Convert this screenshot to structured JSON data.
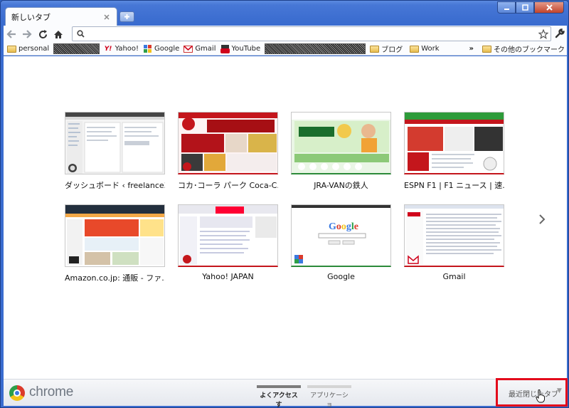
{
  "window": {
    "buttons": [
      "minimize",
      "maximize",
      "close"
    ]
  },
  "tab": {
    "title": "新しいタブ",
    "close_icon": "close-icon",
    "new_tab_icon": "plus-icon"
  },
  "toolbar": {
    "back_icon": "back-arrow-icon",
    "forward_icon": "forward-arrow-icon",
    "reload_icon": "reload-icon",
    "home_icon": "home-icon",
    "omnibox_value": "",
    "search_icon": "search-icon",
    "star_icon": "star-icon",
    "wrench_icon": "wrench-icon"
  },
  "bookmarks": {
    "personal": "personal",
    "yahoo": "Yahoo!",
    "google": "Google",
    "gmail": "Gmail",
    "youtube": "YouTube",
    "blog": "ブログ",
    "work": "Work",
    "overflow": "»",
    "other": "その他のブックマーク"
  },
  "thumbnails": [
    {
      "title": "ダッシュボード ‹ freelance3..."
    },
    {
      "title": "コカ･コーラ パーク Coca-C..."
    },
    {
      "title": "JRA-VANの鉄人"
    },
    {
      "title": "ESPN F1 | F1 ニュース | 速..."
    },
    {
      "title": "Amazon.co.jp: 通販 - ファ..."
    },
    {
      "title": "Yahoo! JAPAN"
    },
    {
      "title": "Google"
    },
    {
      "title": "Gmail"
    }
  ],
  "footer": {
    "brand": "chrome",
    "tab_most_visited": "よくアクセスす",
    "tab_apps": "アプリケーショ",
    "recently_closed": "最近閉じたタブ",
    "recently_closed_arrow": "▼"
  },
  "colors": {
    "highlight_border": "#e3081b",
    "frame_blue": "#3a6ccf"
  }
}
